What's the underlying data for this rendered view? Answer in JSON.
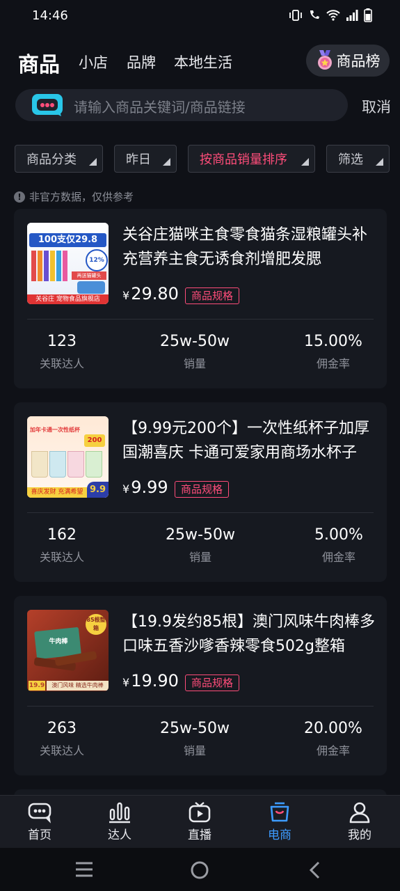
{
  "status_bar": {
    "time": "14:46"
  },
  "nav": {
    "title": "商品",
    "tabs": [
      "小店",
      "品牌",
      "本地生活"
    ],
    "rank_button": "商品榜"
  },
  "search": {
    "placeholder": "请输入商品关键词/商品链接",
    "cancel": "取消"
  },
  "filters": [
    {
      "label": "商品分类",
      "active": false
    },
    {
      "label": "昨日",
      "active": false
    },
    {
      "label": "按商品销量排序",
      "active": true
    },
    {
      "label": "筛选",
      "active": false
    }
  ],
  "notice": "非官方数据，仅供参考",
  "products": [
    {
      "title": "关谷庄猫咪主食零食猫条湿粮罐头补充营养主食无诱食剂增肥发腮",
      "price": "29.80",
      "spec_label": "商品规格",
      "thumb": {
        "headline": "100支仅29.8",
        "badge": "12%",
        "footer": "关谷庄 宠物食品旗舰店",
        "tag": "再送猫罐头"
      },
      "stats": [
        {
          "value": "123",
          "label": "关联达人"
        },
        {
          "value": "25w-50w",
          "label": "销量"
        },
        {
          "value": "15.00%",
          "label": "佣金率"
        }
      ]
    },
    {
      "title": "【9.99元200个】一次性纸杯子加厚国潮喜庆 卡通可爱家用商场水杯子",
      "price": "9.99",
      "spec_label": "商品规格",
      "thumb": {
        "headline": "加年卡通一次性纸杯",
        "badge": "200",
        "footer": "喜庆发财 充满希望",
        "tag": "9.9"
      },
      "stats": [
        {
          "value": "162",
          "label": "关联达人"
        },
        {
          "value": "25w-50w",
          "label": "销量"
        },
        {
          "value": "5.00%",
          "label": "佣金率"
        }
      ]
    },
    {
      "title": "【19.9发约85根】澳门风味牛肉棒多口味五香沙嗲香辣零食502g整箱",
      "price": "19.90",
      "spec_label": "商品规格",
      "thumb": {
        "headline": "牛肉棒",
        "badge": "85根整箱",
        "footer": "澳门风味 精选牛肉棒",
        "tag": "19.9"
      },
      "stats": [
        {
          "value": "263",
          "label": "关联达人"
        },
        {
          "value": "25w-50w",
          "label": "销量"
        },
        {
          "value": "20.00%",
          "label": "佣金率"
        }
      ]
    }
  ],
  "tab_bar": [
    {
      "label": "首页",
      "icon": "home-chat-icon",
      "active": false
    },
    {
      "label": "达人",
      "icon": "bar-chart-icon",
      "active": false
    },
    {
      "label": "直播",
      "icon": "tv-play-icon",
      "active": false
    },
    {
      "label": "电商",
      "icon": "shopping-bag-icon",
      "active": true
    },
    {
      "label": "我的",
      "icon": "user-icon",
      "active": false
    }
  ],
  "colors": {
    "accent": "#ff4d7a",
    "active_tab": "#3d9bff",
    "background": "#0f1117",
    "card": "#161920"
  }
}
